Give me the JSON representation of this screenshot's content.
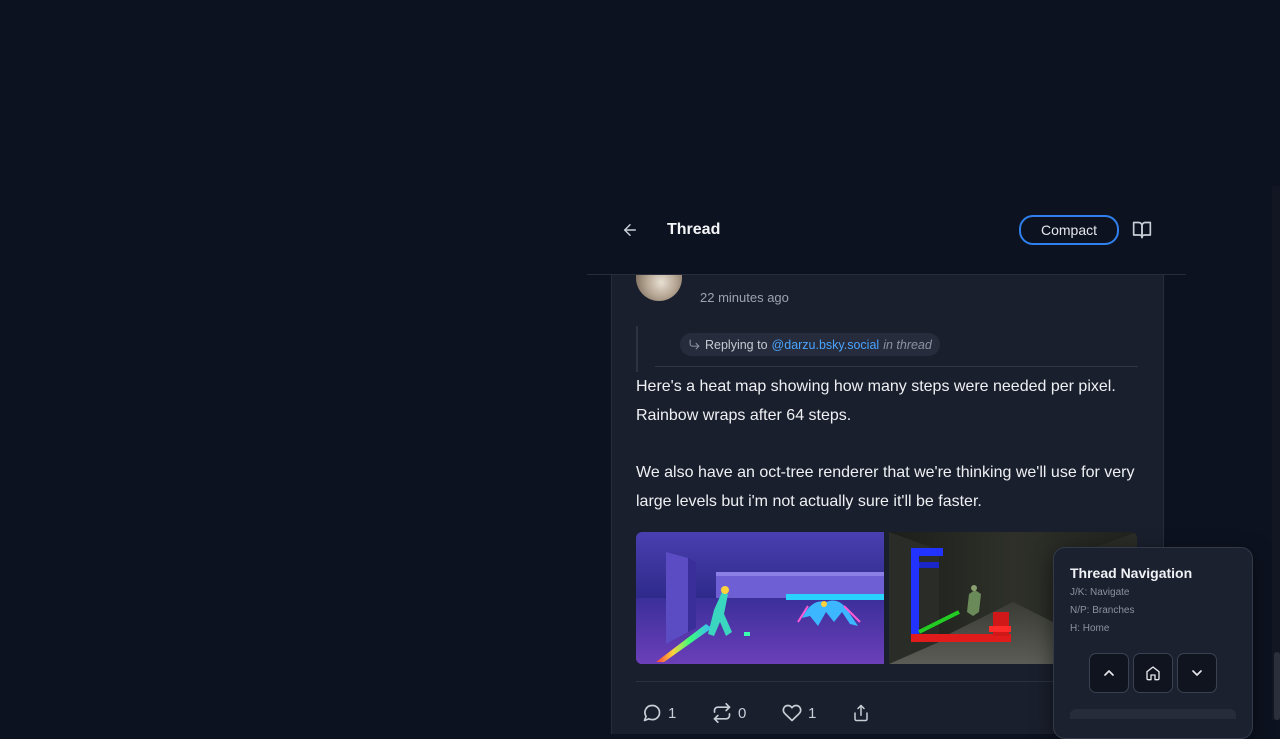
{
  "header": {
    "title": "Thread",
    "compact_label": "Compact"
  },
  "post": {
    "timestamp": "22 minutes ago",
    "reply": {
      "prefix": "Replying to",
      "handle": "@darzu.bsky.social",
      "context": "in thread"
    },
    "paragraphs": [
      "Here's a heat map showing how many steps were needed per pixel. Rainbow wraps after 64 steps.",
      "We also have an oct-tree renderer that we're thinking we'll use for very large levels but i'm not actually sure it'll be faster."
    ],
    "actions": {
      "replies": "1",
      "reposts": "0",
      "likes": "1"
    }
  },
  "nav_panel": {
    "title": "Thread Navigation",
    "hints": [
      "J/K: Navigate",
      "N/P: Branches",
      "H: Home"
    ]
  },
  "icons": [
    "arrow-left-icon",
    "book-open-icon",
    "corner-down-right-icon",
    "comment-icon",
    "repost-icon",
    "heart-icon",
    "share-icon",
    "chevron-up-icon",
    "home-icon",
    "chevron-down-icon"
  ],
  "colors": {
    "accent": "#2f80ed",
    "link": "#4aa3ff",
    "background": "#0d1220",
    "card": "#1a1f2d"
  }
}
